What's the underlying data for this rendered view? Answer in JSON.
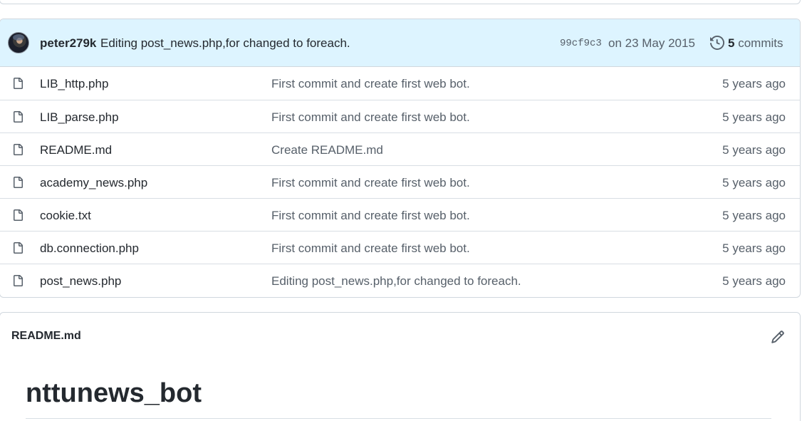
{
  "commit": {
    "author": "peter279k",
    "message": "Editing post_news.php,for changed to foreach.",
    "sha": "99cf9c3",
    "date": "on 23 May 2015",
    "commit_count": "5",
    "commits_label": "commits"
  },
  "files": [
    {
      "name": "LIB_http.php",
      "message": "First commit and create first web bot.",
      "age": "5 years ago"
    },
    {
      "name": "LIB_parse.php",
      "message": "First commit and create first web bot.",
      "age": "5 years ago"
    },
    {
      "name": "README.md",
      "message": "Create README.md",
      "age": "5 years ago"
    },
    {
      "name": "academy_news.php",
      "message": "First commit and create first web bot.",
      "age": "5 years ago"
    },
    {
      "name": "cookie.txt",
      "message": "First commit and create first web bot.",
      "age": "5 years ago"
    },
    {
      "name": "db.connection.php",
      "message": "First commit and create first web bot.",
      "age": "5 years ago"
    },
    {
      "name": "post_news.php",
      "message": "Editing post_news.php,for changed to foreach.",
      "age": "5 years ago"
    }
  ],
  "readme": {
    "filename": "README.md",
    "heading": "nttunews_bot"
  },
  "icons": {
    "file": "file-icon",
    "history": "history-icon",
    "edit": "pencil-icon"
  }
}
